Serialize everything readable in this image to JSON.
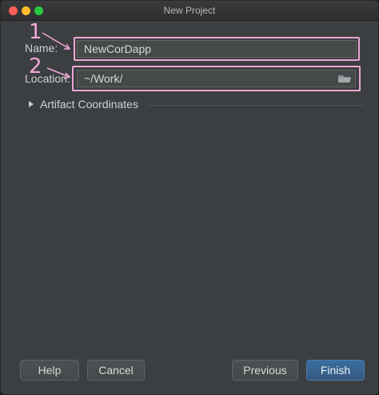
{
  "window": {
    "title": "New Project"
  },
  "form": {
    "name_label": "Name:",
    "name_value": "NewCorDapp",
    "location_label": "Location:",
    "location_value": "~/Work/"
  },
  "annotations": {
    "marker_1": "1",
    "marker_2": "2",
    "color": "#e8a6d2"
  },
  "artifact": {
    "label": "Artifact Coordinates"
  },
  "buttons": {
    "help": "Help",
    "cancel": "Cancel",
    "previous": "Previous",
    "finish": "Finish"
  },
  "icons": {
    "folder": "folder-icon",
    "expand": "triangle-right-icon"
  }
}
